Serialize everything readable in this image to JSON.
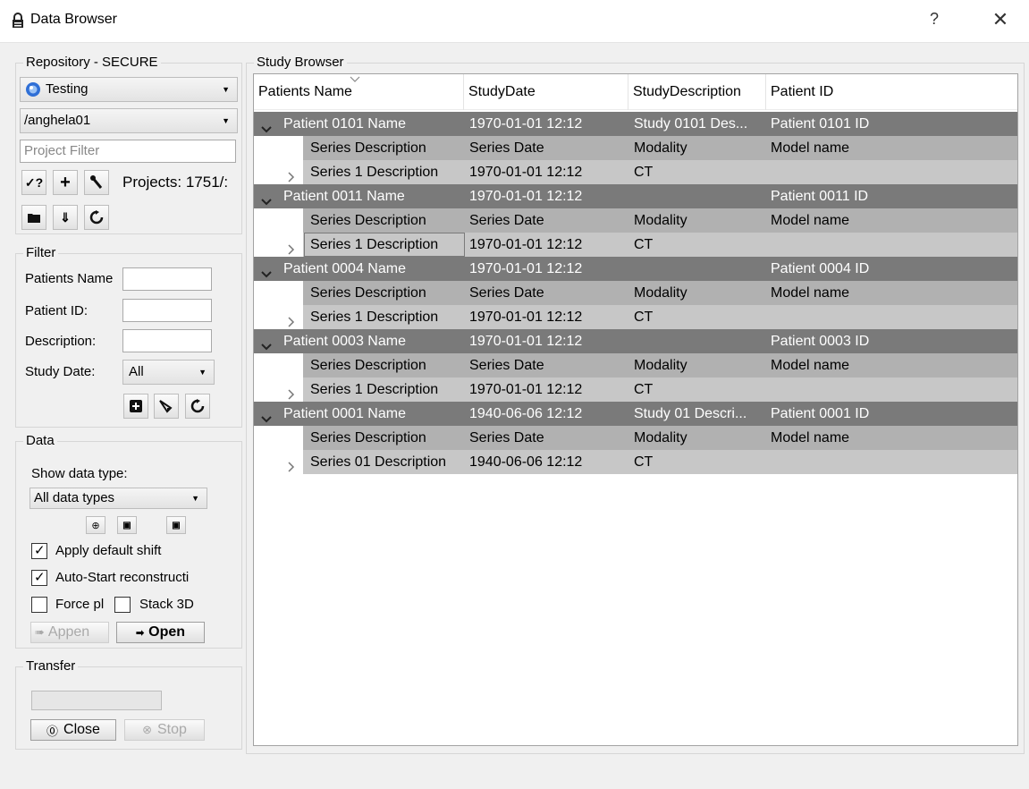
{
  "window": {
    "title": "Data Browser",
    "help": "?",
    "close": "✕"
  },
  "repository": {
    "group_title": "Repository - SECURE",
    "server": "Testing",
    "project": "/anghela01",
    "project_filter_placeholder": "Project Filter",
    "projects_count": "Projects: 1751/:"
  },
  "filter": {
    "group_title": "Filter",
    "patients_name_label": "Patients Name",
    "patient_id_label": "Patient ID:",
    "description_label": "Description:",
    "study_date_label": "Study Date:",
    "study_date_value": "All"
  },
  "data": {
    "group_title": "Data",
    "show_type_label": "Show data type:",
    "type_value": "All data types",
    "apply_shift_label": "Apply default shift",
    "apply_shift_checked": true,
    "auto_start_label": "Auto-Start reconstructi",
    "auto_start_checked": true,
    "force_label": "Force pl",
    "force_checked": false,
    "stack_label": "Stack 3D",
    "stack_checked": false,
    "append_label": "Appen",
    "open_label": "Open"
  },
  "transfer": {
    "group_title": "Transfer",
    "progress": 0,
    "close_label": "Close",
    "stop_label": "Stop"
  },
  "study_browser": {
    "group_title": "Study Browser",
    "columns": [
      "Patients Name",
      "StudyDate",
      "StudyDescription",
      "Patient ID"
    ],
    "patients": [
      {
        "name": "Patient 0101 Name",
        "date": "1970-01-01 12:12",
        "description": "Study 0101 Des...",
        "id": "Patient 0101 ID",
        "series_header": [
          "Series Description",
          "Series Date",
          "Modality",
          "Model name"
        ],
        "series": [
          [
            "Series 1 Description",
            "1970-01-01 12:12",
            "CT",
            ""
          ]
        ]
      },
      {
        "name": "Patient 0011 Name",
        "date": "1970-01-01 12:12",
        "description": "",
        "id": "Patient 0011 ID",
        "series_header": [
          "Series Description",
          "Series Date",
          "Modality",
          "Model name"
        ],
        "series": [
          [
            "Series 1 Description",
            "1970-01-01 12:12",
            "CT",
            ""
          ]
        ]
      },
      {
        "name": "Patient 0004 Name",
        "date": "1970-01-01 12:12",
        "description": "",
        "id": "Patient 0004 ID",
        "series_header": [
          "Series Description",
          "Series Date",
          "Modality",
          "Model name"
        ],
        "series": [
          [
            "Series 1 Description",
            "1970-01-01 12:12",
            "CT",
            ""
          ]
        ]
      },
      {
        "name": "Patient 0003 Name",
        "date": "1970-01-01 12:12",
        "description": "",
        "id": "Patient 0003 ID",
        "series_header": [
          "Series Description",
          "Series Date",
          "Modality",
          "Model name"
        ],
        "series": [
          [
            "Series 1 Description",
            "1970-01-01 12:12",
            "CT",
            ""
          ]
        ]
      },
      {
        "name": "Patient 0001 Name",
        "date": "1940-06-06 12:12",
        "description": "Study 01 Descri...",
        "id": "Patient 0001 ID",
        "series_header": [
          "Series Description",
          "Series Date",
          "Modality",
          "Model name"
        ],
        "series": [
          [
            "Series 01 Description",
            "1940-06-06 12:12",
            "CT",
            ""
          ]
        ]
      }
    ]
  },
  "icons": {
    "lock": "lock-icon",
    "server": "server-icon",
    "check_question": "check-question-icon",
    "add": "plus-icon",
    "wrench": "wrench-icon",
    "folder": "folder-icon",
    "download": "download-icon",
    "refresh": "refresh-icon"
  },
  "colors": {
    "patient_row": "#7a7a7a",
    "series_header_row": "#b1b1b1",
    "series_row": "#c7c7c7",
    "server_icon": "#2f6fd6"
  }
}
